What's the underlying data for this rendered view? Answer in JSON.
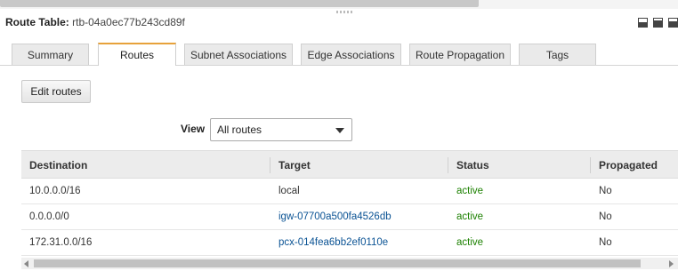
{
  "header": {
    "label": "Route Table:",
    "route_table_id": "rtb-04a0ec77b243cd89f"
  },
  "tabs": [
    {
      "label": "Summary",
      "active": false
    },
    {
      "label": "Routes",
      "active": true
    },
    {
      "label": "Subnet Associations",
      "active": false
    },
    {
      "label": "Edge Associations",
      "active": false
    },
    {
      "label": "Route Propagation",
      "active": false
    },
    {
      "label": "Tags",
      "active": false
    }
  ],
  "toolbar": {
    "edit_routes_label": "Edit routes"
  },
  "filter": {
    "label": "View",
    "selected": "All routes"
  },
  "table": {
    "columns": [
      "Destination",
      "Target",
      "Status",
      "Propagated"
    ],
    "rows": [
      {
        "destination": "10.0.0.0/16",
        "target": "local",
        "target_is_link": false,
        "status": "active",
        "propagated": "No"
      },
      {
        "destination": "0.0.0.0/0",
        "target": "igw-07700a500fa4526db",
        "target_is_link": true,
        "status": "active",
        "propagated": "No"
      },
      {
        "destination": "172.31.0.0/16",
        "target": "pcx-014fea6bb2ef0110e",
        "target_is_link": true,
        "status": "active",
        "propagated": "No"
      }
    ]
  },
  "colors": {
    "accent_tab": "#e7a23b",
    "link": "#0b5394",
    "status_active": "#1d8102"
  },
  "icons": [
    "layout-bottom-icon",
    "layout-split-icon",
    "layout-full-icon"
  ]
}
